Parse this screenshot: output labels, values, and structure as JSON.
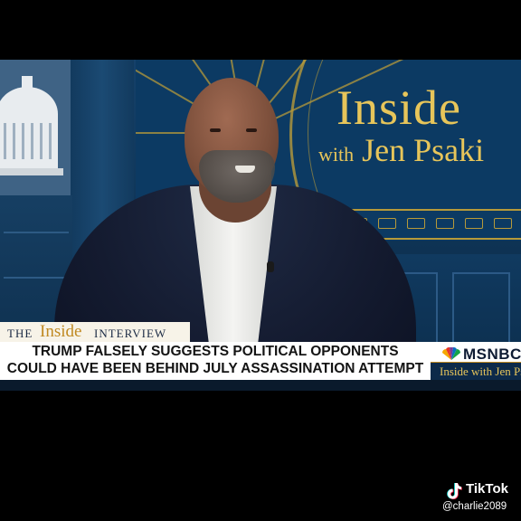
{
  "video": {
    "show_logo": {
      "line1": "Inside",
      "with": "with",
      "host": "Jen Psaki"
    },
    "lower_third": {
      "segment_the": "THE",
      "segment_inside": "Inside",
      "segment_interview": "INTERVIEW",
      "headline_line1": "TRUMP FALSELY SUGGESTS POLITICAL OPPONENTS",
      "headline_line2": "COULD HAVE BEEN BEHIND JULY ASSASSINATION ATTEMPT",
      "network": "MSNBC",
      "show_tag": "Inside with Jen Psaki"
    }
  },
  "watermark": {
    "brand": "TikTok",
    "handle": "@charlie2089"
  },
  "colors": {
    "gold": "#e7c55a",
    "navy": "#0c3a63",
    "background": "#000000"
  },
  "icons": {
    "tiktok": "tiktok-logo-icon",
    "network": "peacock-icon"
  }
}
